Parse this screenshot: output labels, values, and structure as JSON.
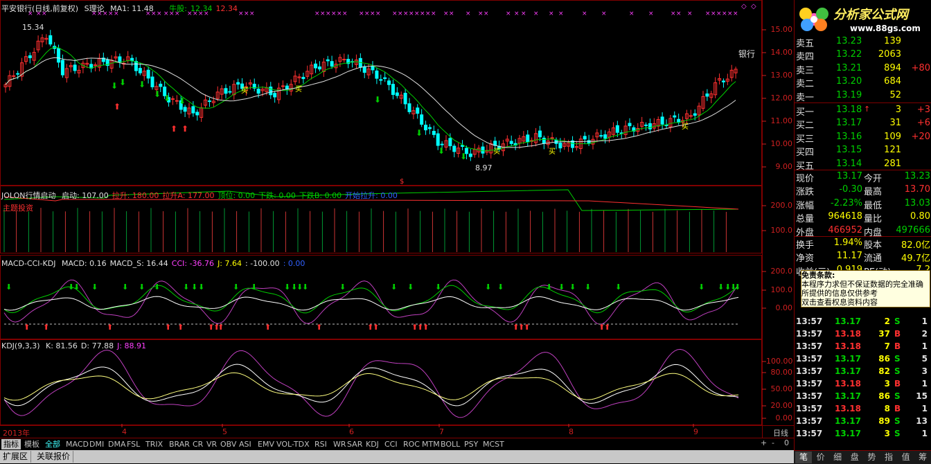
{
  "main_header": {
    "title": "平安银行(日线,前复权)",
    "indicator": "S理论",
    "ma_label": "MA1: 11.48",
    "bull_label": "牛股:",
    "bull_value": "12.34",
    "bull_value2": "12.34"
  },
  "main_annotations": {
    "high_price": "15.34",
    "low_price": "8.97",
    "sector_tag": "银行",
    "buy_word": "买",
    "dollar_mark": "$"
  },
  "main_axis": [
    "15.00",
    "14.00",
    "13.00",
    "12.00",
    "11.00",
    "10.00",
    "9.00"
  ],
  "jolon": {
    "name": "JOLON行情启动",
    "fields": [
      {
        "label": "启动: 107.00",
        "color": "#e0e0e0"
      },
      {
        "label": "拉升: 180.00",
        "color": "#ff3030"
      },
      {
        "label": "拉升A: 177.00",
        "color": "#ff3030"
      },
      {
        "label": "顶位: 0.00",
        "color": "#00d000"
      },
      {
        "label": "下跌: 0.00",
        "color": "#00d000"
      },
      {
        "label": "下跌B: 0.00",
        "color": "#00d000"
      },
      {
        "label": "开始拉升: 0.00",
        "color": "#3060ff"
      }
    ],
    "sub_label": "主题投资",
    "axis": [
      "200.0",
      "100.0"
    ]
  },
  "macd": {
    "name": "MACD-CCI-KDJ",
    "fields": [
      {
        "label": "MACD: 0.16",
        "color": "#e0e0e0"
      },
      {
        "label": "MACD_S: 16.44",
        "color": "#e0e0e0"
      },
      {
        "label": "CCI: -36.76",
        "color": "#ff40ff"
      },
      {
        "label": "J: 7.64",
        "color": "#ffff00"
      },
      {
        "label": ": -100.00",
        "color": "#e0e0e0"
      },
      {
        "label": ": 0.00",
        "color": "#3060ff"
      }
    ],
    "axis": [
      "200.0",
      "100.0",
      "0.00"
    ]
  },
  "kdj": {
    "name": "KDJ(9,3,3)",
    "fields": [
      {
        "label": "K: 81.56",
        "color": "#e0e0e0"
      },
      {
        "label": "D: 77.88",
        "color": "#e0e0e0"
      },
      {
        "label": "J: 88.91",
        "color": "#ff40ff"
      }
    ],
    "axis": [
      "100.00",
      "80.00",
      "50.00",
      "20.00",
      "0.00"
    ]
  },
  "time_axis": {
    "labels": [
      "2013年",
      "4",
      "5",
      "6",
      "7",
      "8",
      "9"
    ],
    "period": "日线"
  },
  "indicator_tabs": [
    "指标",
    "模板",
    "全部",
    "MACD",
    "DMI",
    "DMA",
    "FSL",
    "TRIX",
    "BRAR",
    "CR",
    "VR",
    "OBV",
    "ASI",
    "EMV",
    "VOL-TDX",
    "RSI",
    "WR",
    "SAR",
    "KDJ",
    "CCI",
    "ROC",
    "MTM",
    "BOLL",
    "PSY",
    "MCST"
  ],
  "zoom_controls": {
    "plus": "+",
    "minus": "-",
    "zero": "0"
  },
  "bottom_tabs": [
    "扩展区",
    "关联报价"
  ],
  "logo": {
    "brand": "分析家公式网",
    "url_text": "www.88gs.com"
  },
  "quote": {
    "sell": [
      {
        "label": "卖五",
        "price": "13.23",
        "vol": "139",
        "chg": ""
      },
      {
        "label": "卖四",
        "price": "13.22",
        "vol": "2063",
        "chg": ""
      },
      {
        "label": "卖三",
        "price": "13.21",
        "vol": "894",
        "chg": "+80"
      },
      {
        "label": "卖二",
        "price": "13.20",
        "vol": "684",
        "chg": ""
      },
      {
        "label": "卖一",
        "price": "13.19",
        "vol": "52",
        "chg": ""
      }
    ],
    "buy": [
      {
        "label": "买一",
        "price": "13.18",
        "vol": "3",
        "chg": "+3",
        "arrow": "↑"
      },
      {
        "label": "买二",
        "price": "13.17",
        "vol": "31",
        "chg": "+6",
        "arrow": ""
      },
      {
        "label": "买三",
        "price": "13.16",
        "vol": "109",
        "chg": "+20",
        "arrow": ""
      },
      {
        "label": "买四",
        "price": "13.15",
        "vol": "121",
        "chg": "",
        "arrow": ""
      },
      {
        "label": "买五",
        "price": "13.14",
        "vol": "281",
        "chg": "",
        "arrow": ""
      }
    ],
    "stats": [
      {
        "l1": "现价",
        "v1": "13.17",
        "l2": "今开",
        "v2": "13.23",
        "c1": "#00d000",
        "c2": "#00d000"
      },
      {
        "l1": "涨跌",
        "v1": "-0.30",
        "l2": "最高",
        "v2": "13.70",
        "c1": "#00d000",
        "c2": "#ff3030"
      },
      {
        "l1": "涨幅",
        "v1": "-2.23%",
        "l2": "最低",
        "v2": "13.03",
        "c1": "#00d000",
        "c2": "#00d000"
      },
      {
        "l1": "总量",
        "v1": "964618",
        "l2": "量比",
        "v2": "0.80",
        "c1": "#ffff00",
        "c2": "#ffff00"
      },
      {
        "l1": "外盘",
        "v1": "466952",
        "l2": "内盘",
        "v2": "497666",
        "c1": "#ff3030",
        "c2": "#00d000"
      }
    ],
    "stats2": [
      {
        "l1": "换手",
        "v1": "1.94%",
        "l2": "股本",
        "v2": "82.0亿"
      },
      {
        "l1": "净资",
        "v1": "11.17",
        "l2": "流通",
        "v2": "49.7亿"
      },
      {
        "l1": "收益(三)",
        "v1": "0.919",
        "l2": "PE(动)",
        "v2": "7.2"
      }
    ],
    "ticks": [
      {
        "t": "13:57",
        "p": "13.17",
        "v": "2",
        "s": "S",
        "n": "1"
      },
      {
        "t": "13:57",
        "p": "13.18",
        "v": "37",
        "s": "B",
        "n": "2"
      },
      {
        "t": "13:57",
        "p": "13.18",
        "v": "7",
        "s": "B",
        "n": "1"
      },
      {
        "t": "13:57",
        "p": "13.17",
        "v": "86",
        "s": "S",
        "n": "5"
      },
      {
        "t": "13:57",
        "p": "13.17",
        "v": "82",
        "s": "S",
        "n": "3"
      },
      {
        "t": "13:57",
        "p": "13.18",
        "v": "3",
        "s": "B",
        "n": "1"
      },
      {
        "t": "13:57",
        "p": "13.17",
        "v": "86",
        "s": "S",
        "n": "15"
      },
      {
        "t": "13:57",
        "p": "13.18",
        "v": "8",
        "s": "B",
        "n": "1"
      },
      {
        "t": "13:57",
        "p": "13.17",
        "v": "89",
        "s": "S",
        "n": "13"
      },
      {
        "t": "13:57",
        "p": "13.17",
        "v": "3",
        "s": "S",
        "n": "1"
      }
    ],
    "tabs": [
      "笔",
      "价",
      "细",
      "盘",
      "势",
      "指",
      "值",
      "筹"
    ]
  },
  "disclaimer": {
    "title": "免责条款:",
    "lines": [
      "本程序力求但不保证数据的完全准确",
      "所提供的信息仅供参考",
      "双击查看权息资料内容"
    ]
  },
  "colors": {
    "up": "#ff3030",
    "down": "#00ffff",
    "frame": "#800000",
    "ma_white": "#e0e0e0",
    "ma_green": "#00d000"
  }
}
